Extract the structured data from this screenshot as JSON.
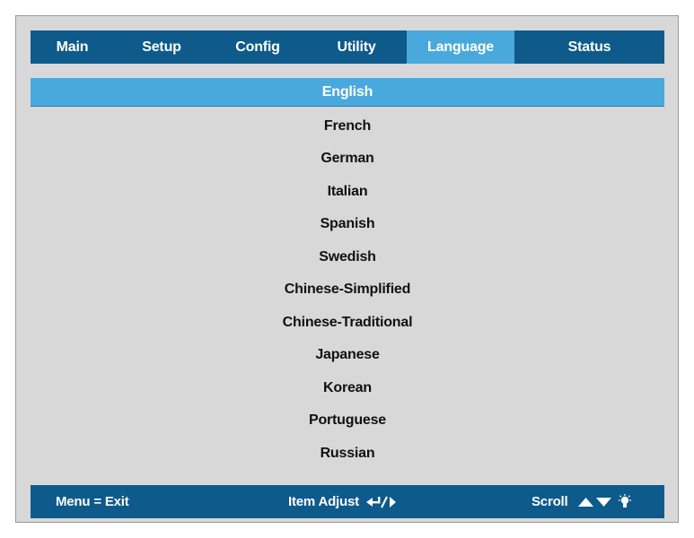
{
  "tabs": [
    {
      "label": "Main",
      "active": false
    },
    {
      "label": "Setup",
      "active": false
    },
    {
      "label": "Config",
      "active": false
    },
    {
      "label": "Utility",
      "active": false
    },
    {
      "label": "Language",
      "active": true
    },
    {
      "label": "Status",
      "active": false
    }
  ],
  "languages": [
    "English",
    "French",
    "German",
    "Italian",
    "Spanish",
    "Swedish",
    "Chinese-Simplified",
    "Chinese-Traditional",
    "Japanese",
    "Korean",
    "Portuguese",
    "Russian"
  ],
  "selected_language": "English",
  "footer": {
    "menu_hint": "Menu = Exit",
    "adjust_label": "Item Adjust",
    "adjust_icon": "enter-right-arrow-icon",
    "scroll_label": "Scroll",
    "scroll_icon": "up-down-arrows-icon",
    "lamp_icon": "lamp-icon"
  },
  "colors": {
    "bar": "#0e5a8b",
    "highlight": "#4aa9dc",
    "panel": "#d8d8d8"
  }
}
